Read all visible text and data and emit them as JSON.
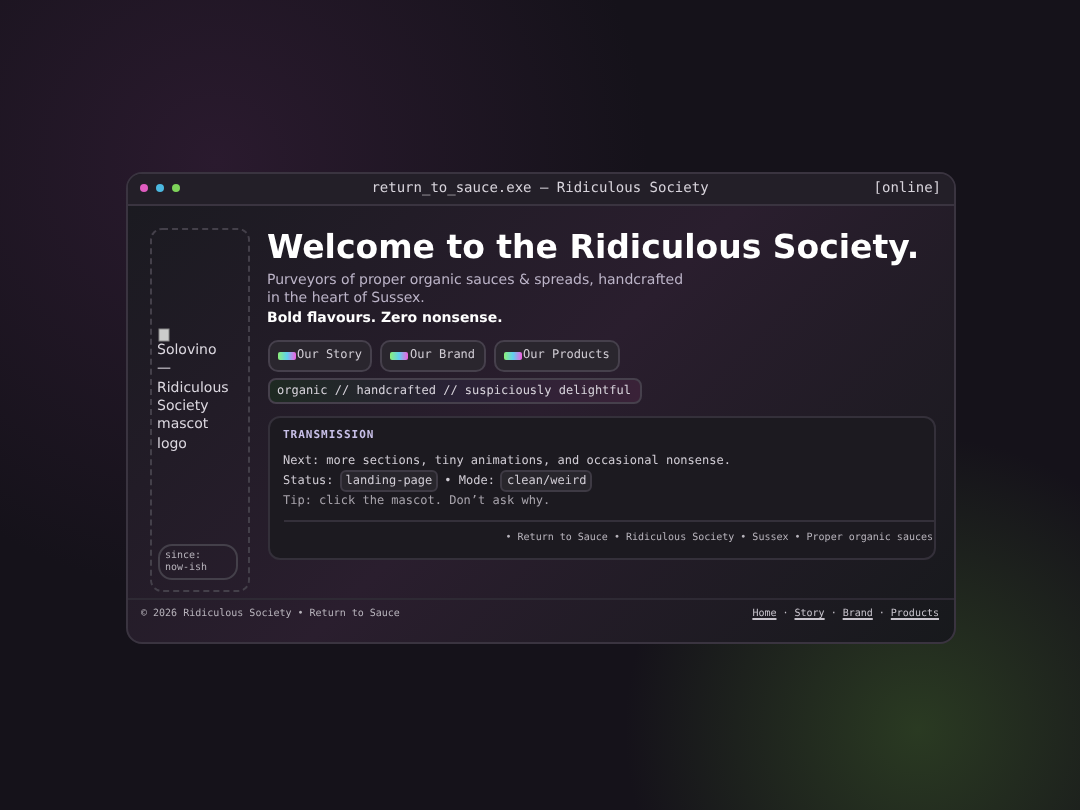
{
  "window": {
    "title": "return_to_sauce.exe — Ridiculous Society",
    "status": "[online]"
  },
  "sidebar": {
    "logo_alt": "Solovino — Ridiculous Society mascot logo",
    "since": "since: now-ish"
  },
  "hero": {
    "heading": "Welcome to the Ridiculous Society.",
    "intro": "Purveyors of proper organic sauces & spreads, handcrafted in the heart of Sussex.",
    "tagline": "Bold flavours. Zero nonsense.",
    "buttons": [
      {
        "label": "Our Story"
      },
      {
        "label": "Our Brand"
      },
      {
        "label": "Our Products"
      }
    ],
    "motto": "organic // handcrafted // suspiciously delightful"
  },
  "transmission": {
    "title": "TRANSMISSION",
    "next": "Next: more sections, tiny animations, and occasional nonsense.",
    "status_label": "Status:",
    "status": "landing-page",
    "mode_label": "• Mode:",
    "mode": "clean/weird",
    "tip": "Tip: click the mascot. Don’t ask why.",
    "ticker": "• Return to Sauce • Ridiculous Society • Sussex • Proper organic sauces"
  },
  "footer": {
    "copyright": "© 2026 Ridiculous Society • Return to Sauce",
    "links": [
      "Home",
      "Story",
      "Brand",
      "Products"
    ],
    "separator": "·"
  }
}
